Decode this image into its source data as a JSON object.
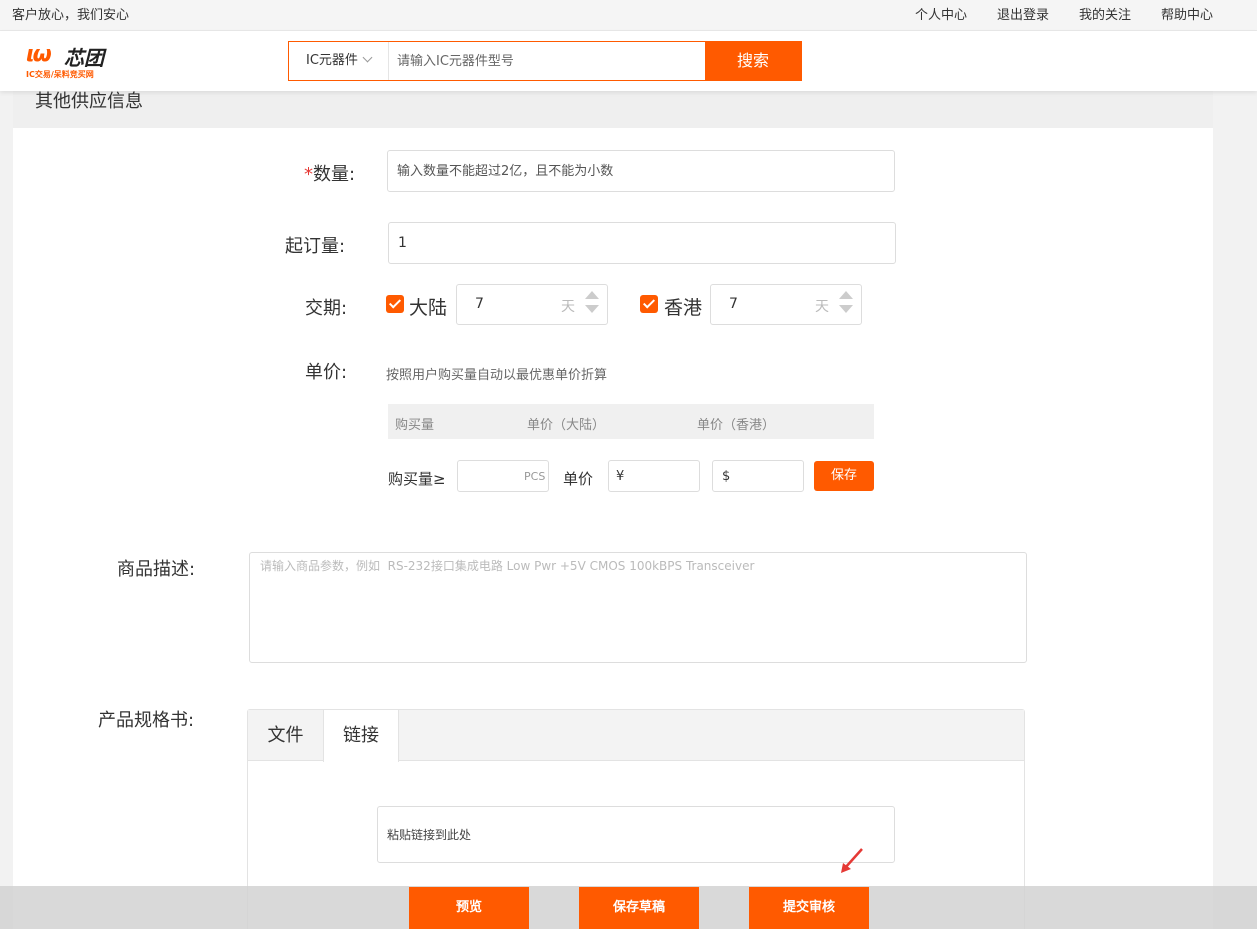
{
  "topbar": {
    "slogan": "客户放心，我们安心",
    "nav": [
      "个人中心",
      "退出登录",
      "我的关注",
      "帮助中心"
    ]
  },
  "logo": {
    "mark": "ιω",
    "name": "芯团",
    "tagline": "IC交易/呆料竞买网"
  },
  "search": {
    "category": "IC元器件",
    "placeholder": "请输入IC元器件型号",
    "button": "搜索"
  },
  "section": {
    "title": "其他供应信息"
  },
  "form": {
    "quantity": {
      "required_mark": "*",
      "label": "数量:",
      "placeholder": "输入数量不能超过2亿，且不能为小数"
    },
    "moq": {
      "label": "起订量:",
      "value": "1"
    },
    "delivery": {
      "label": "交期:",
      "mainland": {
        "label": "大陆",
        "value": "7",
        "unit": "天"
      },
      "hongkong": {
        "label": "香港",
        "value": "7",
        "unit": "天"
      }
    },
    "price": {
      "label": "单价:",
      "hint": "按照用户购买量自动以最优惠单价折算",
      "columns": [
        "购买量",
        "单价（大陆）",
        "单价（香港）"
      ],
      "row": {
        "qty_label": "购买量≥",
        "qty_unit": "PCS",
        "price_label": "单价",
        "cny_symbol": "¥",
        "usd_symbol": "$",
        "save": "保存"
      }
    },
    "description": {
      "label": "商品描述:",
      "placeholder": "请输入商品参数，例如  RS-232接口集成电路 Low Pwr +5V CMOS 100kBPS Transceiver"
    },
    "spec": {
      "label": "产品规格书:",
      "tabs": [
        "文件",
        "链接"
      ],
      "active_tab": "链接",
      "link_placeholder": "粘贴链接到此处"
    }
  },
  "footer": {
    "buttons": [
      "预览",
      "保存草稿",
      "提交审核"
    ]
  },
  "colors": {
    "accent": "#ff5a00",
    "annotation": "#e53935"
  }
}
